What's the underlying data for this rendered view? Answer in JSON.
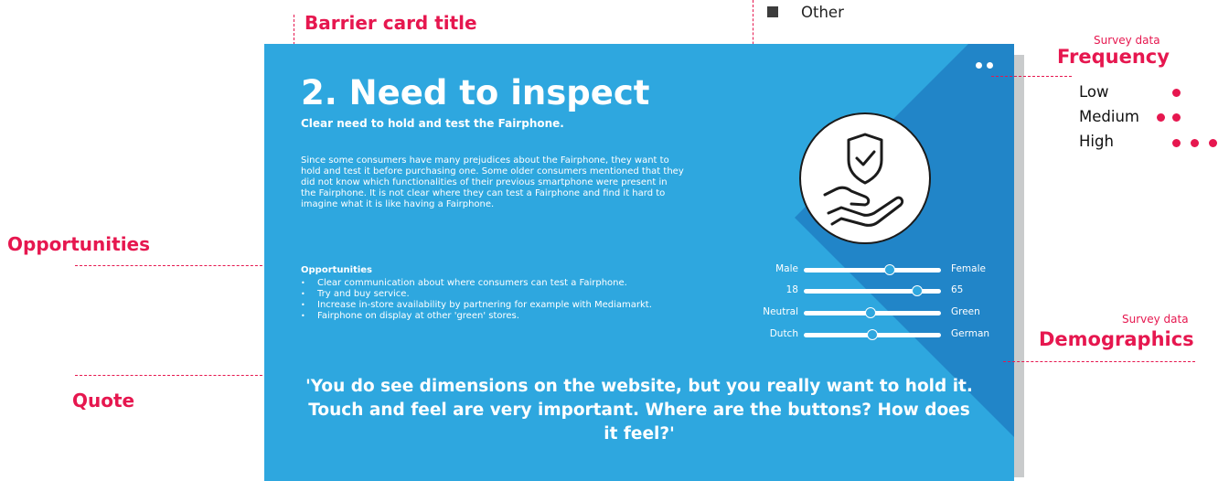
{
  "annotations": {
    "barrier_card_title": "Barrier card title",
    "opportunities": "Opportunities",
    "quote": "Quote",
    "frequency_caption": "Survey data",
    "frequency": "Frequency",
    "demographics_caption": "Survey data",
    "demographics": "Demographics"
  },
  "legend_other": "Other",
  "frequency_levels": [
    {
      "label": "Low",
      "dots": 1
    },
    {
      "label": "Medium",
      "dots": 2
    },
    {
      "label": "High",
      "dots": 3
    }
  ],
  "card": {
    "title": "2. Need to inspect",
    "subtitle": "Clear need to hold and test the Fairphone.",
    "body": "Since some consumers have many prejudices about the Fairphone, they want to hold and test it before purchasing one. Some older consumers mentioned that they did not know which functionalities of their previous smartphone were present in the Fairphone. It is not clear where they can test a Fairphone and find it hard to imagine what it is like having a Fairphone.",
    "opportunities_heading": "Opportunities",
    "opportunities": [
      "Clear communication about where consumers can test a Fairphone.",
      "Try and buy service.",
      "Increase in-store availability by partnering for example with Mediamarkt.",
      "Fairphone on display at other 'green' stores."
    ],
    "quote": "'You do see dimensions on the website, but you really want to hold it. Touch and feel are very important. Where are the buttons? How does it feel?'",
    "frequency_dots": 2,
    "icon": "hand-shield-check-icon",
    "background_color": "#2ea7df",
    "shadow_color": "#2185c8"
  },
  "demographics": [
    {
      "left": "Male",
      "right": "Female",
      "value": 0.63
    },
    {
      "left": "18",
      "right": "65",
      "value": 0.83
    },
    {
      "left": "Neutral",
      "right": "Green",
      "value": 0.49
    },
    {
      "left": "Dutch",
      "right": "German",
      "value": 0.5
    }
  ],
  "accent_color": "#e6174f"
}
